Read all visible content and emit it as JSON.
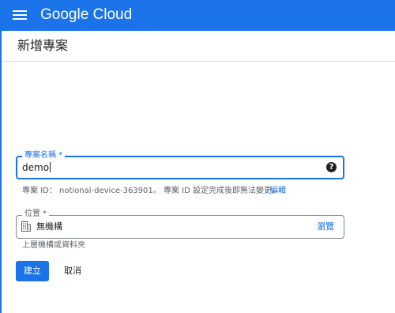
{
  "header": {
    "brand": "Google Cloud",
    "menu_icon": "hamburger-menu-icon",
    "brand_color": "#1a73e8"
  },
  "page": {
    "title": "新增專案"
  },
  "form": {
    "project_name": {
      "label": "專案名稱 *",
      "value": "demo",
      "help_icon": "help-circle-icon"
    },
    "project_id_line": "專案 ID：  notional-device-363901。 專案 ID 設定完成後即無法變更。",
    "edit_link": "編輯",
    "location": {
      "label": "位置 *",
      "icon": "building-icon",
      "value": "無機構",
      "browse": "瀏覽",
      "helper": "上層機構或資料夾"
    },
    "buttons": {
      "create": "建立",
      "cancel": "取消"
    }
  }
}
